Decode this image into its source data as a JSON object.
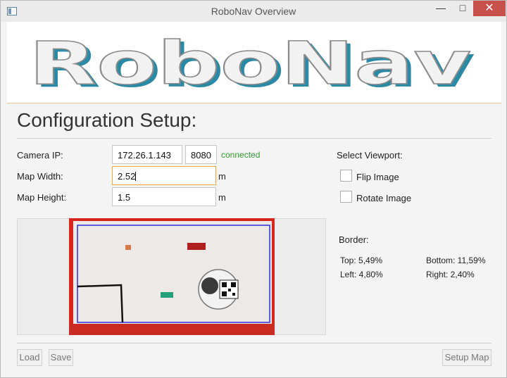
{
  "window": {
    "title": "RoboNav Overview"
  },
  "banner": {
    "logo_text": "RoboNav"
  },
  "heading": "Configuration Setup:",
  "camera": {
    "label": "Camera IP:",
    "ip": "172.26.1.143",
    "port": "8080",
    "status": "connected"
  },
  "map_width": {
    "label": "Map Width:",
    "value": "2.52",
    "unit": "m"
  },
  "map_height": {
    "label": "Map Height:",
    "value": "1.5",
    "unit": "m"
  },
  "viewport": {
    "title": "Select Viewport:",
    "flip": {
      "label": "Flip Image",
      "checked": false
    },
    "rotate": {
      "label": "Rotate Image",
      "checked": false
    }
  },
  "border": {
    "title": "Border:",
    "top": "Top: 5,49%",
    "bottom": "Bottom: 11,59%",
    "left": "Left: 4,80%",
    "right": "Right: 2,40%"
  },
  "buttons": {
    "load": "Load",
    "save": "Save",
    "setup_map": "Setup Map"
  },
  "colors": {
    "accent_focus": "#f3a935",
    "status_ok": "#2e9a2e",
    "close_button": "#c7504b",
    "logo_teal": "#2a8aa5"
  }
}
